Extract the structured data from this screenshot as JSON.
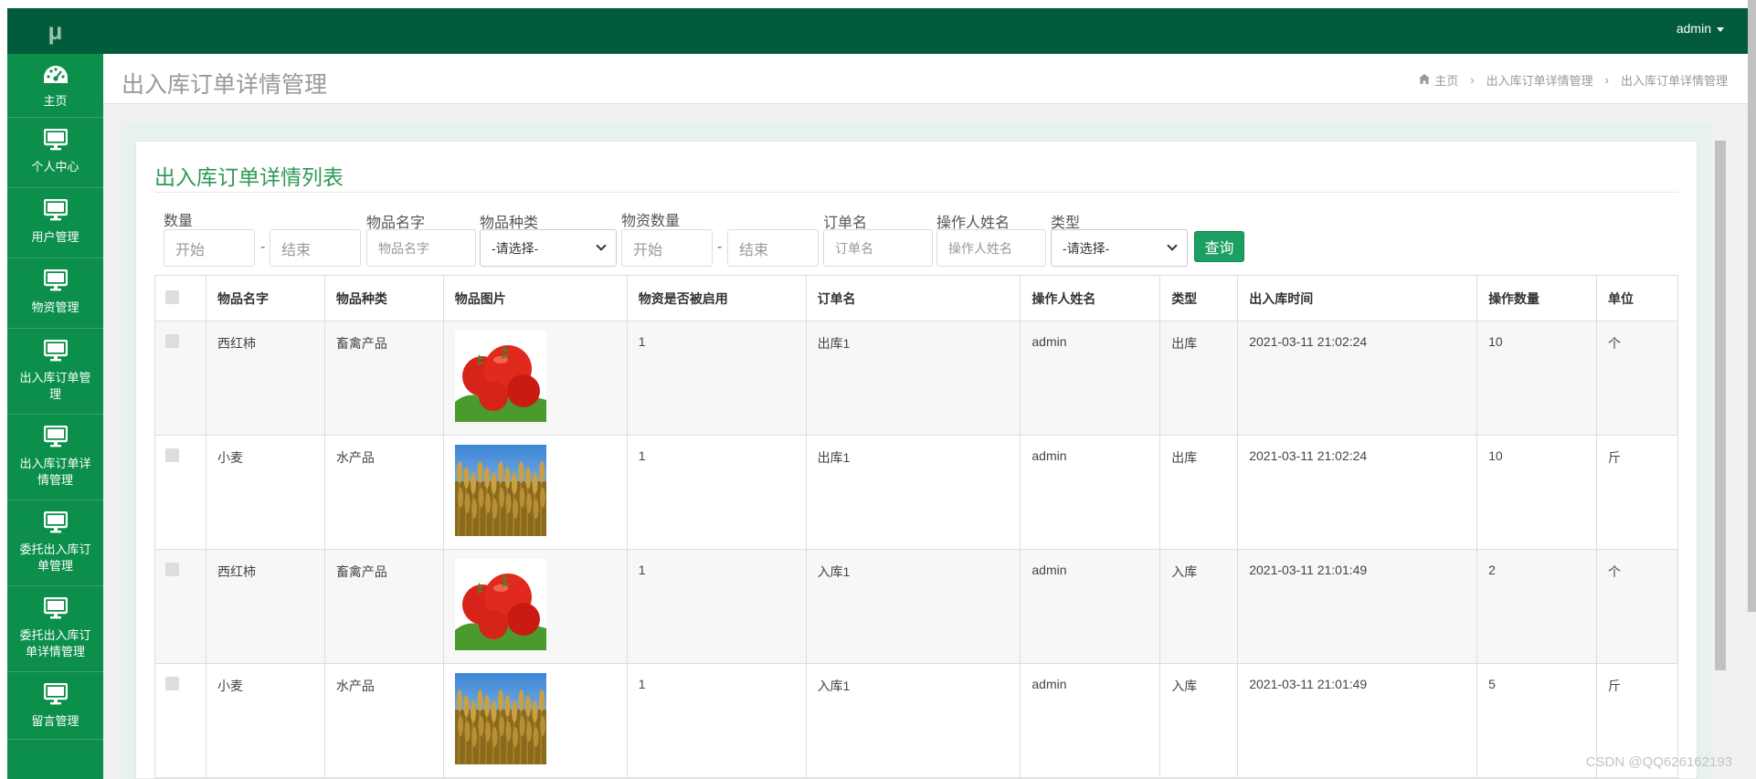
{
  "app": {
    "logo": "μ",
    "user": "admin"
  },
  "sidebar": {
    "items": [
      {
        "label": "主页",
        "icon": "dashboard-icon"
      },
      {
        "label": "个人中心",
        "icon": "monitor-icon"
      },
      {
        "label": "用户管理",
        "icon": "monitor-icon"
      },
      {
        "label": "物资管理",
        "icon": "monitor-icon"
      },
      {
        "label": "出入库订单管理",
        "icon": "monitor-icon"
      },
      {
        "label": "出入库订单详情管理",
        "icon": "monitor-icon"
      },
      {
        "label": "委托出入库订单管理",
        "icon": "monitor-icon"
      },
      {
        "label": "委托出入库订单详情管理",
        "icon": "monitor-icon"
      },
      {
        "label": "留言管理",
        "icon": "monitor-icon"
      }
    ]
  },
  "header": {
    "title": "出入库订单详情管理",
    "breadcrumb": [
      "主页",
      "出入库订单详情管理",
      "出入库订单详情管理"
    ]
  },
  "card": {
    "title": "出入库订单详情列表"
  },
  "filters": {
    "qty_label": "数量",
    "qty_start": "开始",
    "qty_end": "结束",
    "name_label": "物品名字",
    "name_placeholder": "物品名字",
    "category_label": "物品种类",
    "category_value": "-请选择-",
    "stock_label": "物资数量",
    "stock_start": "开始",
    "stock_end": "结束",
    "order_label": "订单名",
    "order_placeholder": "订单名",
    "operator_label": "操作人姓名",
    "operator_placeholder": "操作人姓名",
    "type_label": "类型",
    "type_value": "-请选择-",
    "dash": "-",
    "search_button": "查询"
  },
  "table": {
    "columns": [
      "物品名字",
      "物品种类",
      "物品图片",
      "物资是否被启用",
      "订单名",
      "操作人姓名",
      "类型",
      "出入库时间",
      "操作数量",
      "单位"
    ],
    "rows": [
      {
        "name": "西红柿",
        "category": "畜禽产品",
        "image": "tomato",
        "enabled": "1",
        "order": "出库1",
        "operator": "admin",
        "type": "出库",
        "time": "2021-03-11 21:02:24",
        "qty": "10",
        "unit": "个"
      },
      {
        "name": "小麦",
        "category": "水产品",
        "image": "wheat",
        "enabled": "1",
        "order": "出库1",
        "operator": "admin",
        "type": "出库",
        "time": "2021-03-11 21:02:24",
        "qty": "10",
        "unit": "斤"
      },
      {
        "name": "西红柿",
        "category": "畜禽产品",
        "image": "tomato",
        "enabled": "1",
        "order": "入库1",
        "operator": "admin",
        "type": "入库",
        "time": "2021-03-11 21:01:49",
        "qty": "2",
        "unit": "个"
      },
      {
        "name": "小麦",
        "category": "水产品",
        "image": "wheat",
        "enabled": "1",
        "order": "入库1",
        "operator": "admin",
        "type": "入库",
        "time": "2021-03-11 21:01:49",
        "qty": "5",
        "unit": "斤"
      }
    ]
  },
  "watermark": "CSDN @QQ626162193",
  "colors": {
    "primary": "#0b8f4a",
    "topbar": "#025c3b",
    "accent": "#1d9e62",
    "title": "#2e9a55"
  }
}
